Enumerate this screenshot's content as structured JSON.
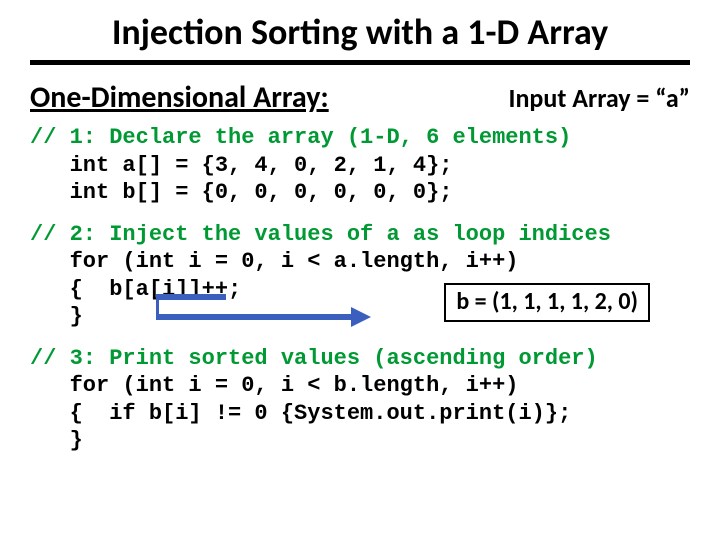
{
  "title": "Injection Sorting with a 1-D Array",
  "subtitle": "One-Dimensional Array:",
  "input_label": "Input Array = “a”",
  "block1": {
    "comment": "// 1: Declare the array (1-D, 6 elements)",
    "line1": "   int a[] = {3, 4, 0, 2, 1, 4};",
    "line2": "   int b[] = {0, 0, 0, 0, 0, 0};"
  },
  "block2": {
    "comment": "// 2: Inject the values of a as loop indices",
    "line1": "   for (int i = 0, i < a.length, i++)",
    "line2": "   {  b[a[i]]++;",
    "line3": "   }",
    "annotation": "b = (1, 1, 1, 1, 2, 0)"
  },
  "block3": {
    "comment": "// 3: Print sorted values (ascending order)",
    "line1": "   for (int i = 0, i < b.length, i++)",
    "line2": "   {  if b[i] != 0 {System.out.print(i)};",
    "line3": "   }"
  }
}
